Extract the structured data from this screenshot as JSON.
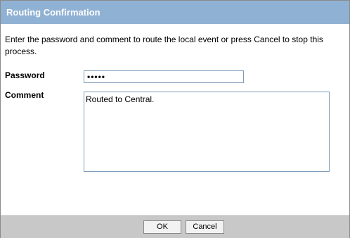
{
  "dialog": {
    "title": "Routing Confirmation",
    "message": "Enter the password and comment to route the local event or press Cancel to stop this process.",
    "password_label": "Password",
    "password_value": "*****",
    "comment_label": "Comment",
    "comment_value": "Routed to Central.",
    "ok_label": "OK",
    "cancel_label": "Cancel"
  },
  "colors": {
    "titlebar": "#8fb1d4",
    "footer": "#c8c8c8",
    "input_border": "#7f9db9"
  }
}
